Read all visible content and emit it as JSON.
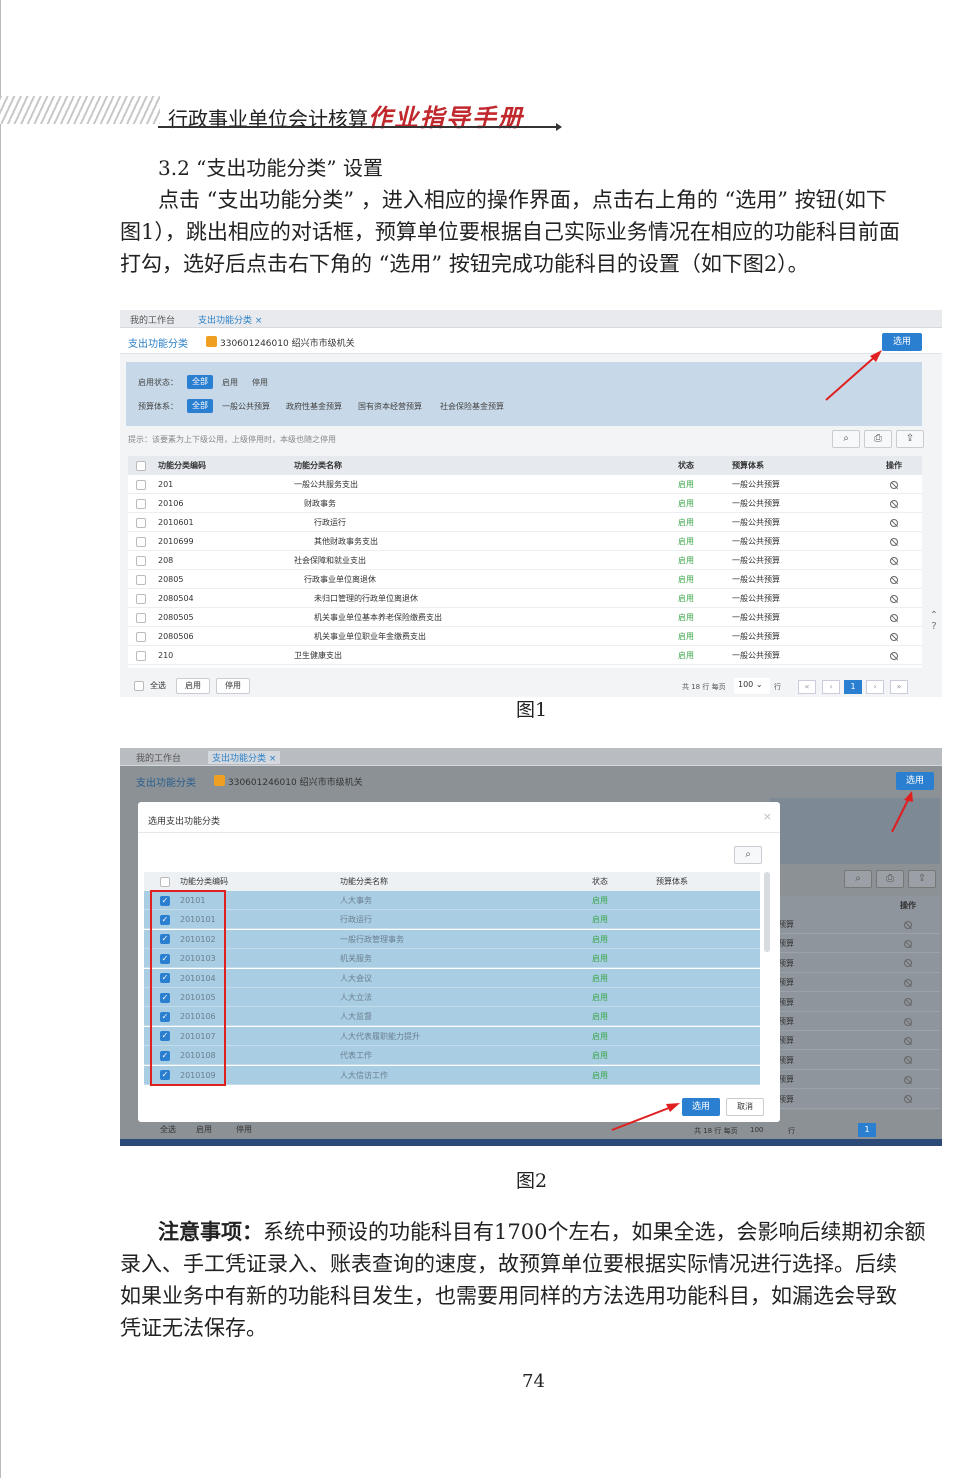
{
  "header": {
    "title_plain": "行政事业单位会计核算",
    "title_red": "作业指导手册"
  },
  "section": {
    "title": "3.2 “支出功能分类” 设置",
    "para_lines": [
      "点击 “支出功能分类” ，进入相应的操作界面，点击右上角的 “选用” 按钮(如下",
      "图1），跳出相应的对话框，预算单位要根据自己实际业务情况在相应的功能科目前面",
      "打勾，选好后点击右下角的 “选用” 按钮完成功能科目的设置（如下图2）。"
    ]
  },
  "fig1": {
    "tabs": [
      "我的工作台",
      "支出功能分类"
    ],
    "crumb": "支出功能分类",
    "org": "330601246010 绍兴市市级机关",
    "select_btn": "选用",
    "filter_status_label": "启用状态：",
    "filter_status": [
      "全部",
      "启用",
      "停用"
    ],
    "filter_budget_label": "预算体系：",
    "filter_budget": [
      "全部",
      "一般公共预算",
      "政府性基金预算",
      "国有资本经营预算",
      "社会保险基金预算"
    ],
    "hint": "提示：该要素为上下级公用，上级停用时，本级也随之停用",
    "columns": [
      "功能分类编码",
      "功能分类名称",
      "状态",
      "预算体系",
      "操作"
    ],
    "rows": [
      [
        "201",
        "一般公共服务支出",
        "启用",
        "一般公共预算"
      ],
      [
        "20106",
        "财政事务",
        "启用",
        "一般公共预算"
      ],
      [
        "2010601",
        "行政运行",
        "启用",
        "一般公共预算"
      ],
      [
        "2010699",
        "其他财政事务支出",
        "启用",
        "一般公共预算"
      ],
      [
        "208",
        "社会保障和就业支出",
        "启用",
        "一般公共预算"
      ],
      [
        "20805",
        "行政事业单位离退休",
        "启用",
        "一般公共预算"
      ],
      [
        "2080504",
        "未归口管理的行政单位离退休",
        "启用",
        "一般公共预算"
      ],
      [
        "2080505",
        "机关事业单位基本养老保险缴费支出",
        "启用",
        "一般公共预算"
      ],
      [
        "2080506",
        "机关事业单位职业年金缴费支出",
        "启用",
        "一般公共预算"
      ],
      [
        "210",
        "卫生健康支出",
        "启用",
        "一般公共预算"
      ]
    ],
    "footer_btns": [
      "全选",
      "启用",
      "停用"
    ],
    "pager_text": "共 18 行  每页",
    "page_size": "100",
    "pager_unit": "行",
    "current_page": "1",
    "caption": "图1"
  },
  "fig2": {
    "tabs": [
      "我的工作台",
      "支出功能分类"
    ],
    "crumb": "支出功能分类",
    "org": "330601246010 绍兴市市级机关",
    "select_btn": "选用",
    "dialog_title": "选用支出功能分类",
    "columns": [
      "功能分类编码",
      "功能分类名称",
      "状态",
      "预算体系"
    ],
    "rows": [
      [
        "20101",
        "人大事务",
        "启用"
      ],
      [
        "2010101",
        "行政运行",
        "启用"
      ],
      [
        "2010102",
        "一般行政管理事务",
        "启用"
      ],
      [
        "2010103",
        "机关服务",
        "启用"
      ],
      [
        "2010104",
        "人大会议",
        "启用"
      ],
      [
        "2010105",
        "人大立法",
        "启用"
      ],
      [
        "2010106",
        "人大监督",
        "启用"
      ],
      [
        "2010107",
        "人大代表履职能力提升",
        "启用"
      ],
      [
        "2010108",
        "代表工作",
        "启用"
      ],
      [
        "2010109",
        "人大信访工作",
        "启用"
      ]
    ],
    "bg_budget": "预算",
    "bg_op_header": "操作",
    "ok_btn": "选用",
    "cancel_btn": "取消",
    "footer_btns": [
      "全选",
      "启用",
      "停用"
    ],
    "pager_text": "共 18 行  每页",
    "page_size": "100",
    "pager_unit": "行",
    "current_page": "1",
    "caption": "图2"
  },
  "note": {
    "label": "注意事项：",
    "lines": [
      "系统中预设的功能科目有1700个左右，如果全选，会影响后续期初余额",
      "录入、手工凭证录入、账表查询的速度，故预算单位要根据实际情况进行选择。后续",
      "如果业务中有新的功能科目发生，也需要用同样的方法选用功能科目，如漏选会导致",
      "凭证无法保存。"
    ]
  },
  "page_number": "74",
  "colors": {
    "accent_red": "#c0282d",
    "ui_blue": "#2b7fd0",
    "status_green": "#3aa54a"
  }
}
